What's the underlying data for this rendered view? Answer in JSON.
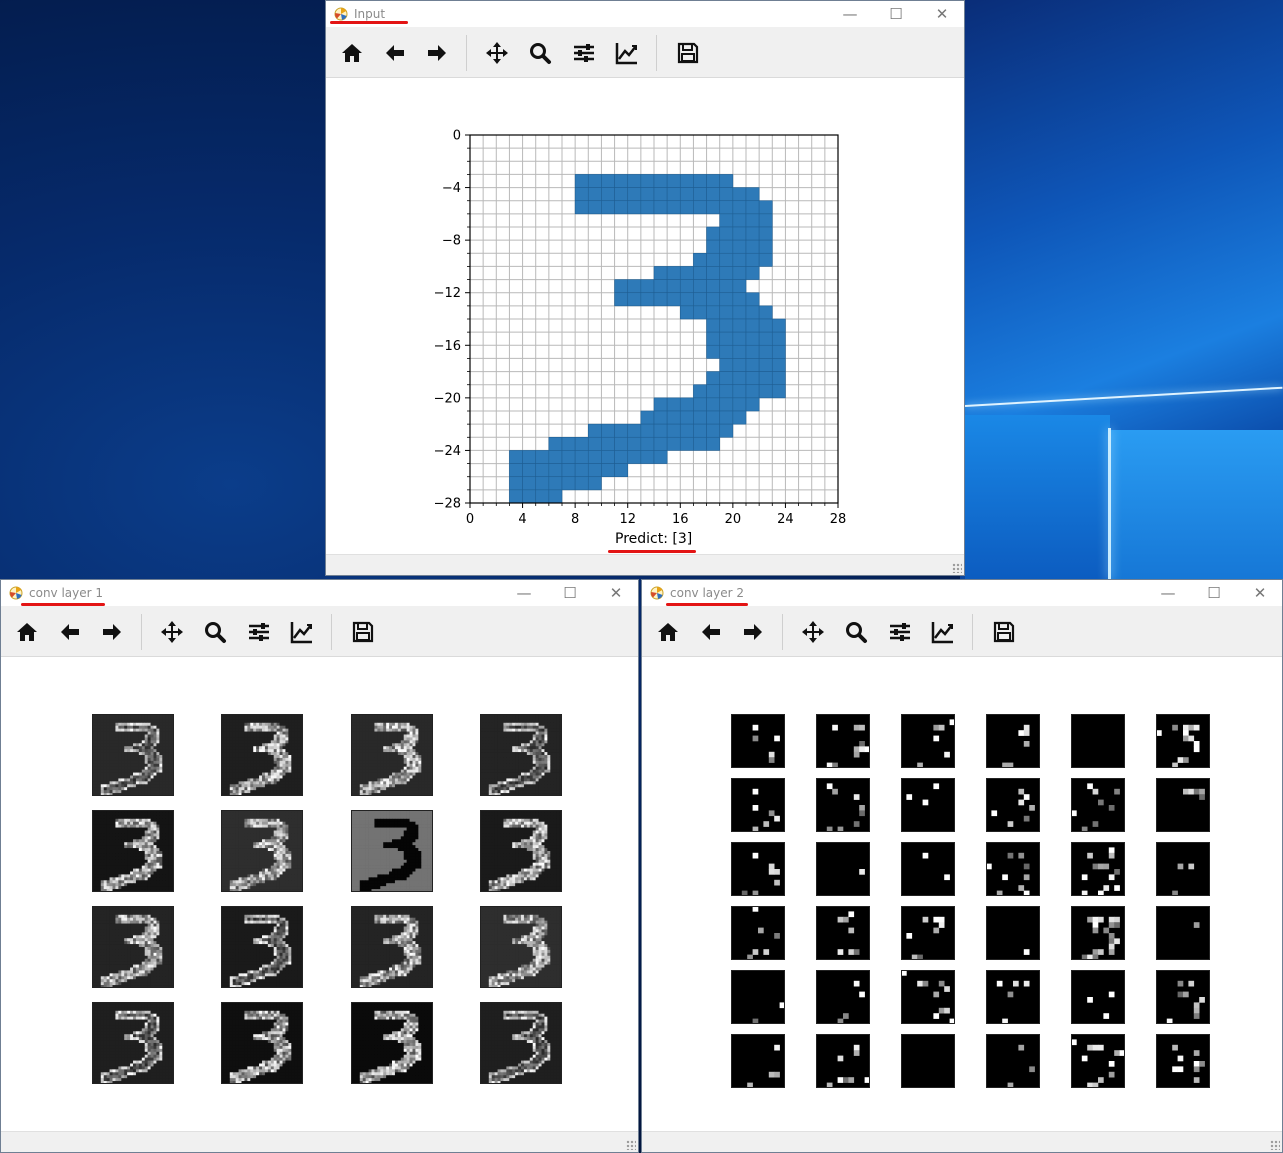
{
  "windows": {
    "input": {
      "title": "Input"
    },
    "conv1": {
      "title": "conv layer 1"
    },
    "conv2": {
      "title": "conv layer 2"
    }
  },
  "window_controls": {
    "minimize": "—",
    "maximize": "☐",
    "close": "✕"
  },
  "toolbar": {
    "buttons": [
      "home-icon",
      "back-arrow-icon",
      "forward-arrow-icon",
      "pan-icon",
      "zoom-icon",
      "configure-subplots-icon",
      "edit-axis-icon",
      "save-icon"
    ]
  },
  "colors": {
    "pixel": "#2e7ab8",
    "grid": "#b9b9b9",
    "underline": "#e31414"
  },
  "chart_data": {
    "type": "heatmap",
    "title": "",
    "xlabel": "Predict: [3]",
    "ylabel": "",
    "xlim": [
      0,
      28
    ],
    "ylim": [
      -28,
      0
    ],
    "x_ticks": [
      "0",
      "4",
      "8",
      "12",
      "16",
      "20",
      "24",
      "28"
    ],
    "y_ticks": [
      "0",
      "−4",
      "−8",
      "−12",
      "−16",
      "−20",
      "−24",
      "−28"
    ],
    "grid": true,
    "rows": [
      "............................",
      "............................",
      "............................",
      "........XXXXXXXXXXXX........",
      "........XXXXXXXXXXXXXX......",
      "........XXXXXXXXXXXXXXX.....",
      "...................XXXX.....",
      "..................XXXXX.....",
      "..................XXXXX.....",
      ".................XXXXXX.....",
      "..............XXXXXXXX......",
      "...........XXXXXXXXXX.......",
      "...........XXXXXXXXXXX......",
      "................XXXXXXX.....",
      "..................XXXXXX....",
      "..................XXXXXX....",
      "..................XXXXXX....",
      "...................XXXXX....",
      "..................XXXXXX....",
      ".................XXXXXXX....",
      "..............XXXXXXXX......",
      ".............XXXXXXXX.......",
      ".........XXXXXXXXXXX........",
      "......XXXXXXXXXXXXX.........",
      "...XXXXXXXXXXXX.............",
      "...XXXXXXXXX................",
      "...XXXXXXX..................",
      "...XXXX....................."
    ]
  },
  "feature_maps": {
    "conv1": {
      "rows": 4,
      "cols": 4,
      "count": 16
    },
    "conv2": {
      "rows": 6,
      "cols": 6,
      "count": 36
    }
  }
}
